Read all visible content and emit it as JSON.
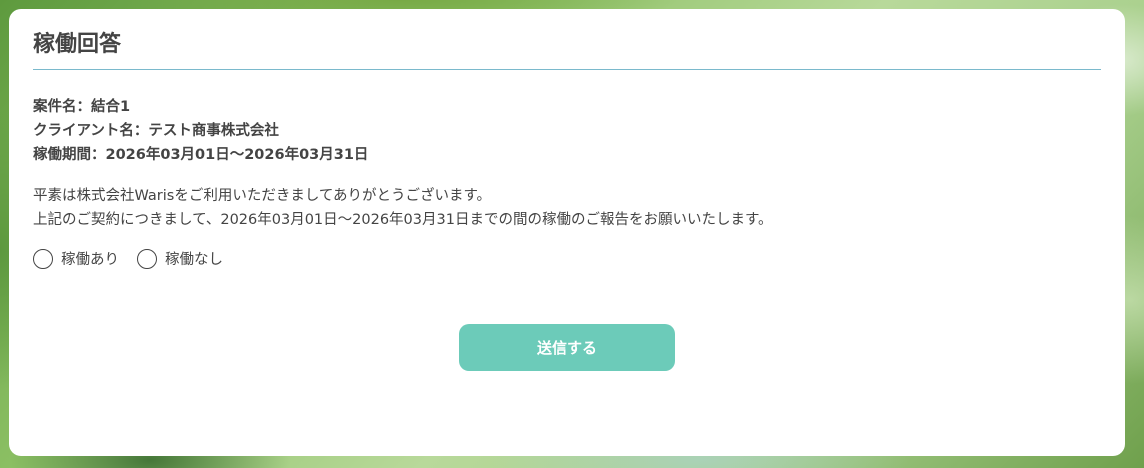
{
  "card": {
    "title": "稼働回答"
  },
  "info": {
    "project": "案件名：結合1",
    "client": "クライアント名：テスト商事株式会社",
    "period": "稼働期間：2026年03月01日〜2026年03月31日"
  },
  "message": {
    "line1": "平素は株式会社Warisをご利用いただきましてありがとうございます。",
    "line2": "上記のご契約につきまして、2026年03月01日〜2026年03月31日までの間の稼働のご報告をお願いいたします。"
  },
  "radios": {
    "options": [
      {
        "label": "稼働あり",
        "selected": false
      },
      {
        "label": "稼働なし",
        "selected": false
      }
    ]
  },
  "submit": {
    "label": "送信する"
  },
  "colors": {
    "accent": "#6ccbb9",
    "divider": "#7ab9cc",
    "text": "#444444"
  }
}
